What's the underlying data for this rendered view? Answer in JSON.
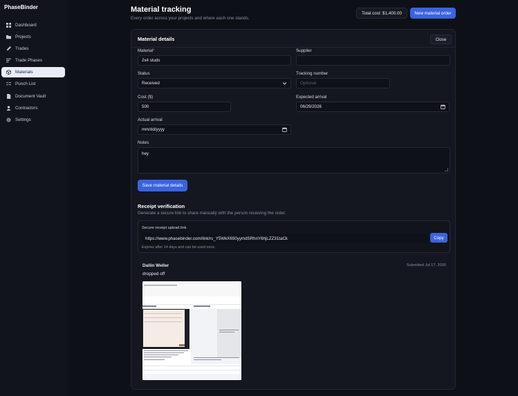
{
  "app": {
    "name": "PhaseBinder"
  },
  "sidebar": {
    "items": [
      {
        "label": "Dashboard",
        "icon": "dashboard-icon"
      },
      {
        "label": "Projects",
        "icon": "folder-icon"
      },
      {
        "label": "Trades",
        "icon": "pencil-icon"
      },
      {
        "label": "Trade Phases",
        "icon": "list-icon"
      },
      {
        "label": "Materials",
        "icon": "box-icon",
        "active": true
      },
      {
        "label": "Punch List",
        "icon": "checklist-icon"
      },
      {
        "label": "Document Vault",
        "icon": "document-icon"
      },
      {
        "label": "Contractors",
        "icon": "person-icon"
      },
      {
        "label": "Settings",
        "icon": "gear-icon"
      }
    ]
  },
  "header": {
    "title": "Material tracking",
    "subtitle": "Every order across your projects and where each one stands.",
    "total_cost": "Total cost: $1,400.00",
    "new_order_label": "New material order"
  },
  "details": {
    "title": "Material details",
    "close_label": "Close",
    "material": {
      "label": "Material",
      "required_mark": "*",
      "value": "2x4 studs"
    },
    "supplier": {
      "label": "Supplier",
      "value": ""
    },
    "status": {
      "label": "Status",
      "value": "Received"
    },
    "tracking": {
      "label": "Tracking number",
      "placeholder": "Optional"
    },
    "cost": {
      "label": "Cost ($)",
      "value": "500"
    },
    "expected": {
      "label": "Expected arrival",
      "value": "06/29/2026"
    },
    "actual": {
      "label": "Actual arrival",
      "placeholder": "mm/dd/yyyy"
    },
    "notes": {
      "label": "Notes",
      "value": "hey"
    },
    "save_label": "Save material details"
  },
  "receipt": {
    "title": "Receipt verification",
    "subtitle": "Generate a secure link to share manually with the person receiving the order.",
    "link_label": "Secure receipt upload link",
    "link_url": "https://www.phasebinder.com/link/rs_Y5WkX650yymdSRhnY6hjLZZ31taCk",
    "copy_label": "Copy",
    "expires_note": "Expires after 14 days and can be used once."
  },
  "submission": {
    "name": "Dallin Weller",
    "date": "Submitted Jul 17, 2026",
    "note": "dropped off"
  },
  "colors": {
    "accent": "#3b63e0",
    "background": "#0e1018",
    "required": "#e05c5c"
  }
}
